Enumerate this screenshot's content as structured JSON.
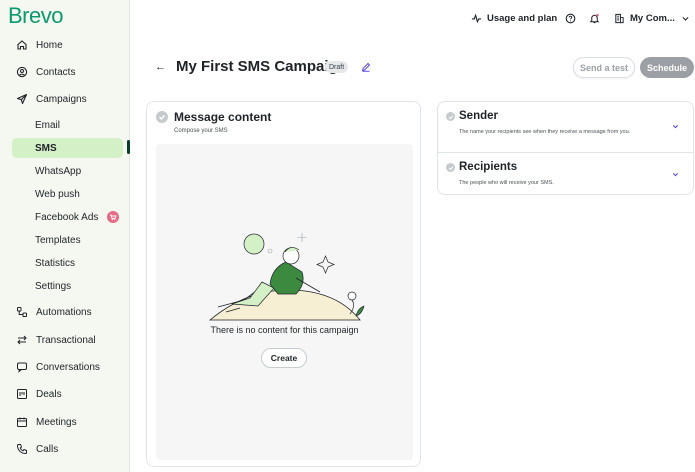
{
  "brand": {
    "logo": "Brevo",
    "accent": "#0b996e"
  },
  "sidebar": {
    "items": [
      {
        "label": "Home",
        "icon": "home-icon"
      },
      {
        "label": "Contacts",
        "icon": "contacts-icon"
      },
      {
        "label": "Campaigns",
        "icon": "send-icon"
      },
      {
        "label": "Automations",
        "icon": "automation-icon"
      },
      {
        "label": "Transactional",
        "icon": "transfer-icon"
      },
      {
        "label": "Conversations",
        "icon": "chat-icon"
      },
      {
        "label": "Deals",
        "icon": "deals-icon"
      },
      {
        "label": "Meetings",
        "icon": "calendar-icon"
      },
      {
        "label": "Calls",
        "icon": "phone-icon"
      }
    ],
    "campaign_sub": [
      {
        "label": "Email"
      },
      {
        "label": "SMS",
        "active": true
      },
      {
        "label": "WhatsApp"
      },
      {
        "label": "Web push"
      },
      {
        "label": "Facebook Ads",
        "badge_icon": "cart-icon"
      },
      {
        "label": "Templates"
      },
      {
        "label": "Statistics"
      },
      {
        "label": "Settings"
      }
    ]
  },
  "topbar": {
    "usage_label": "Usage and plan",
    "account_label": "My Com..."
  },
  "header": {
    "title": "My First SMS Campaign",
    "status": "Draft",
    "send_test_label": "Send a test",
    "schedule_label": "Schedule"
  },
  "message": {
    "title": "Message content",
    "subtitle": "Compose your SMS",
    "empty_text": "There is no content for this campaign",
    "create_label": "Create"
  },
  "sender": {
    "title": "Sender",
    "subtitle": "The name your recipients see when they receive a message from you."
  },
  "recipients": {
    "title": "Recipients",
    "subtitle": "The people who will receive your SMS."
  }
}
